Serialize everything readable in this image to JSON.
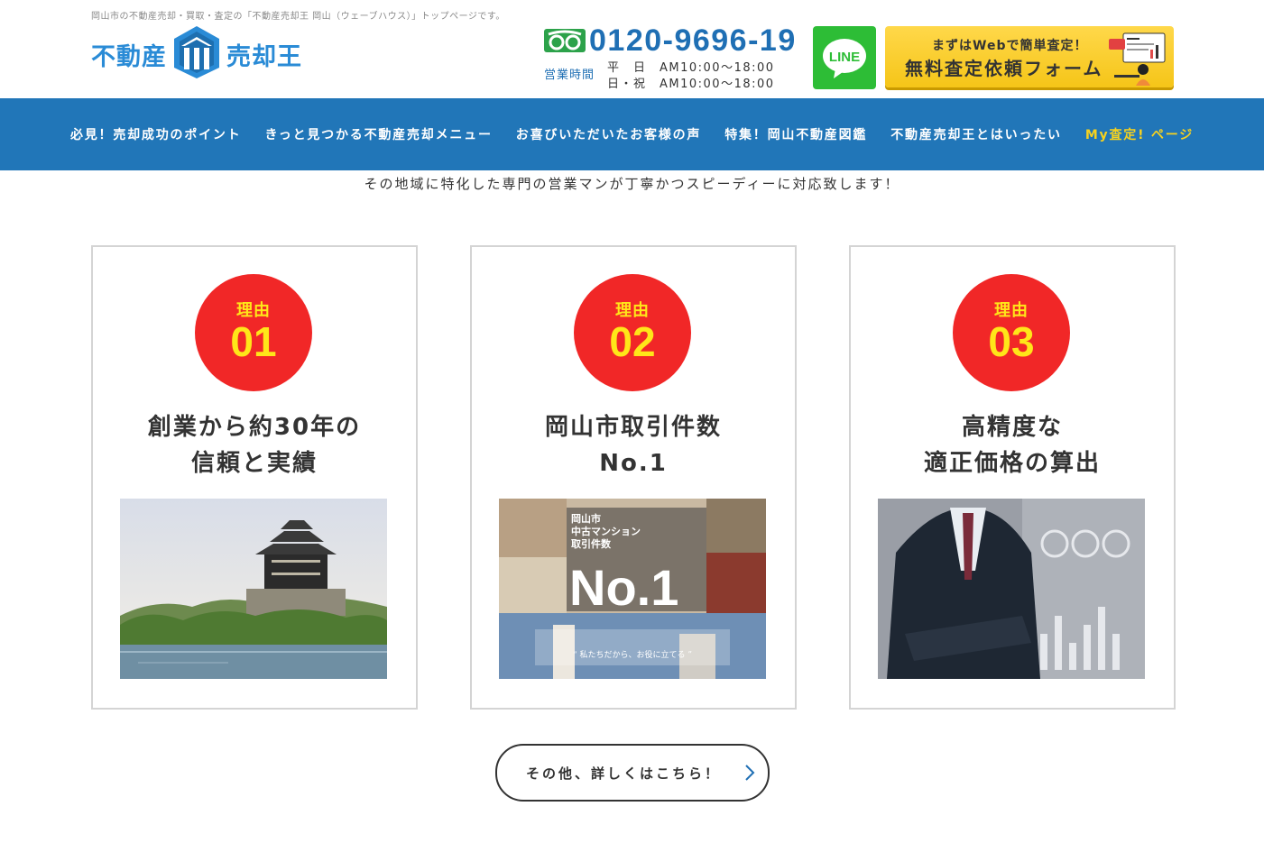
{
  "header": {
    "topline": "岡山市の不動産売却・買取・査定の「不動産売却王 岡山（ウェーブハウス）」トップページです。",
    "logo_left": "不動産",
    "logo_right": "売却王",
    "phone": "0120-9696-19",
    "hours_label": "営業時間",
    "hours_weekday": "平　日　AM10:00〜18:00",
    "hours_holiday": "日・祝　AM10:00〜18:00",
    "line_label": "LINE",
    "form_sub": "まずはWebで簡単査定！",
    "form_main": "無料査定依頼フォーム"
  },
  "nav": {
    "items": [
      "必見！売却成功のポイント",
      "きっと見つかる不動産売却メニュー",
      "お喜びいただいたお客様の声",
      "特集！岡山不動産図鑑",
      "不動産売却王とはいったい",
      "My査定! ページ"
    ]
  },
  "tagline": "その地域に特化した専門の営業マンが丁寧かつスピーディーに対応致します！",
  "reasons": [
    {
      "label": "理由",
      "num": "01",
      "title_line1": "創業から約30年の",
      "title_line2": "信頼と実績"
    },
    {
      "label": "理由",
      "num": "02",
      "title_line1": "岡山市取引件数",
      "title_line2": "No.1"
    },
    {
      "label": "理由",
      "num": "03",
      "title_line1": "高精度な",
      "title_line2": "適正価格の算出"
    }
  ],
  "promo_image": {
    "line1": "岡山市",
    "line2": "中古マンション",
    "line3": "取引件数",
    "big": "No.1",
    "quote": "“ 私たちだから、お役に立てる ”"
  },
  "more_button": "その他、詳しくはこちら！",
  "colors": {
    "brand_blue": "#2176b8",
    "badge_red": "#f12727",
    "badge_yellow": "#ffe619",
    "line_green": "#2dbd36",
    "form_yellow": "#f5c518"
  }
}
